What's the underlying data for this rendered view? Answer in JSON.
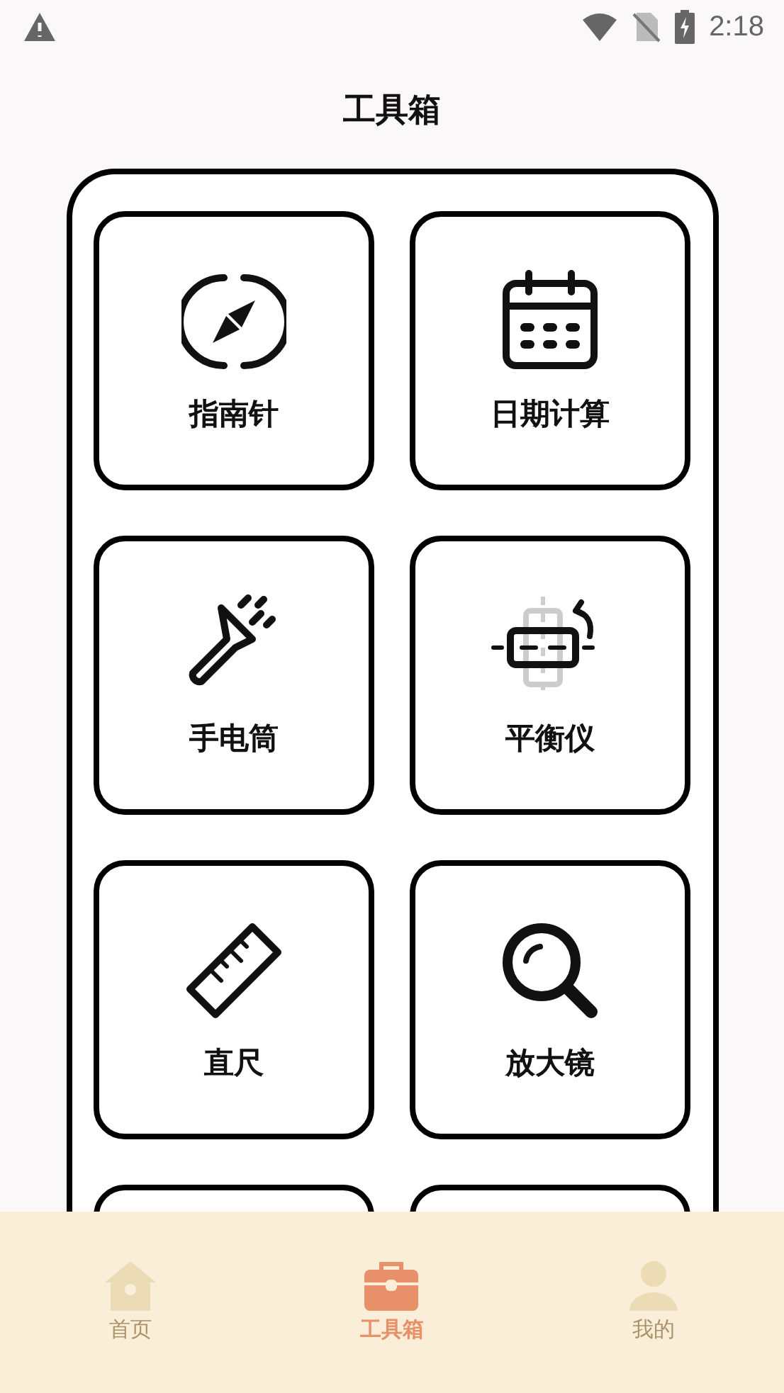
{
  "status_bar": {
    "time": "2:18"
  },
  "title": "工具箱",
  "tools": [
    {
      "label": "指南针"
    },
    {
      "label": "日期计算"
    },
    {
      "label": "手电筒"
    },
    {
      "label": "平衡仪"
    },
    {
      "label": "直尺"
    },
    {
      "label": "放大镜"
    }
  ],
  "nav": [
    {
      "label": "首页",
      "selected": false
    },
    {
      "label": "工具箱",
      "selected": true
    },
    {
      "label": "我的",
      "selected": false
    }
  ]
}
